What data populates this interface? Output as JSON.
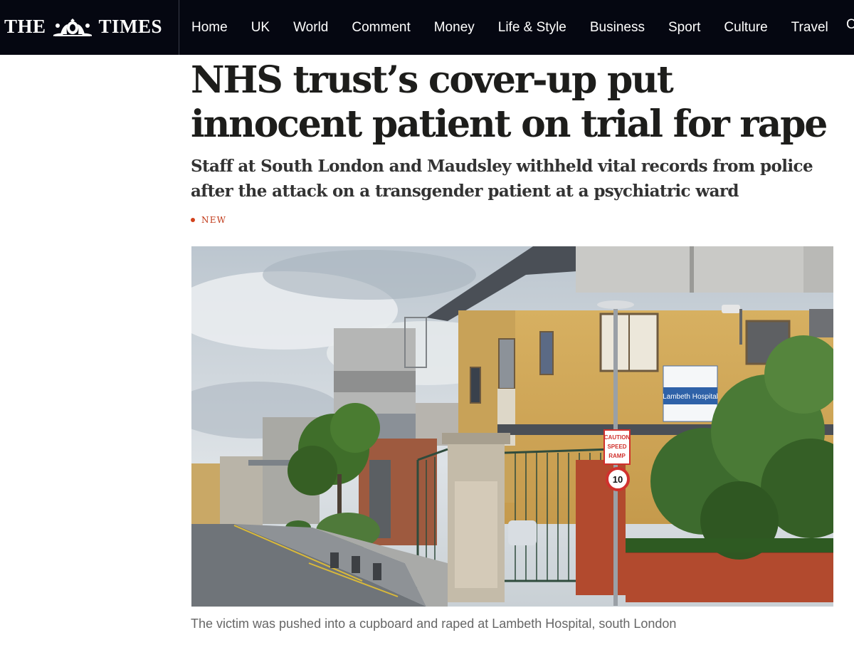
{
  "masthead": {
    "left": "THE",
    "right": "TIMES",
    "crest_icon": "royal-crest-icon"
  },
  "nav": {
    "items": [
      "Home",
      "UK",
      "World",
      "Comment",
      "Money",
      "Life & Style",
      "Business",
      "Sport",
      "Culture",
      "Travel"
    ],
    "overflow_text": "C"
  },
  "article": {
    "headline": "NHS trust’s cover-up put innocent patient on trial for rape",
    "standfirst": "Staff at South London and Maudsley withheld vital records from police after the attack on a transgender patient at a psychiatric ward",
    "tag": "NEW",
    "image": {
      "sign_text": "Lambeth Hospital",
      "warning_sign": [
        "CAUTION",
        "SPEED",
        "RAMP"
      ],
      "speed_limit": "10"
    },
    "caption": "The victim was pushed into a cupboard and raped at Lambeth Hospital, south London"
  },
  "colors": {
    "nav_bg": "#050711",
    "tag": "#c03817",
    "headline": "#1d1d1b"
  }
}
